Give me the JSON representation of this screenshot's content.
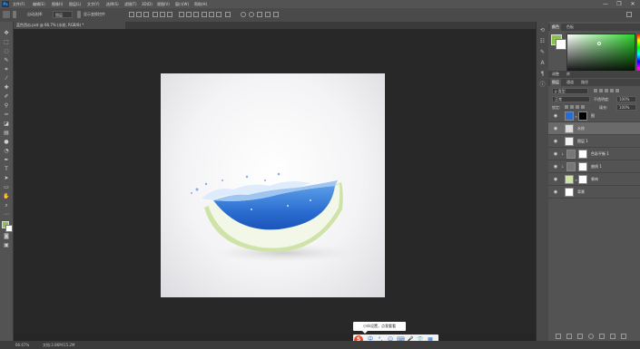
{
  "menubar": {
    "brand": "Ps",
    "items": [
      "文件(F)",
      "编辑(E)",
      "图像(I)",
      "图层(L)",
      "文字(Y)",
      "选择(S)",
      "滤镜(T)",
      "3D(D)",
      "视图(V)",
      "窗口(W)",
      "帮助(H)"
    ],
    "window_controls": [
      "—",
      "❐",
      "✕"
    ]
  },
  "options": {
    "sample_label": "自动选择:",
    "sample_value": "图层",
    "transform_label": "显示变换控件"
  },
  "document": {
    "tab_title": "蓝色西瓜.psd @ 66.7% (水纹, RGB/8) *"
  },
  "status": {
    "zoom": "66.67%",
    "doc_info": "文档:2.86M/15.2M"
  },
  "tooltip": {
    "text": "小伙设置，点我看看"
  },
  "ime": {
    "logo": "S",
    "items": [
      "中",
      "°,",
      "☺",
      "⌨",
      "🎤",
      "👕",
      "▦"
    ]
  },
  "color_panel": {
    "tabs": [
      "颜色",
      "色板"
    ],
    "fg_color": "#8bc34a",
    "bg_color": "#ffffff"
  },
  "mid_panel": {
    "tabs": [
      "调整",
      "库"
    ]
  },
  "layers_panel": {
    "tabs": [
      "图层",
      "通道",
      "路径"
    ],
    "kind_label": "ρ 类型",
    "blend_mode": "正常",
    "opacity_label": "不透明度:",
    "opacity_value": "100%",
    "lock_label": "锁定:",
    "fill_label": "填充:",
    "fill_value": "100%",
    "layers": [
      {
        "name": "图",
        "visible": true,
        "selected": false
      },
      {
        "name": "水纹",
        "visible": true,
        "selected": true
      },
      {
        "name": "图层 1",
        "visible": true,
        "selected": false
      },
      {
        "name": "色彩平衡 1",
        "visible": true,
        "selected": false
      },
      {
        "name": "曲线 1",
        "visible": true,
        "selected": false
      },
      {
        "name": "果肉",
        "visible": true,
        "selected": false
      },
      {
        "name": "背景",
        "visible": true,
        "selected": false
      }
    ]
  }
}
